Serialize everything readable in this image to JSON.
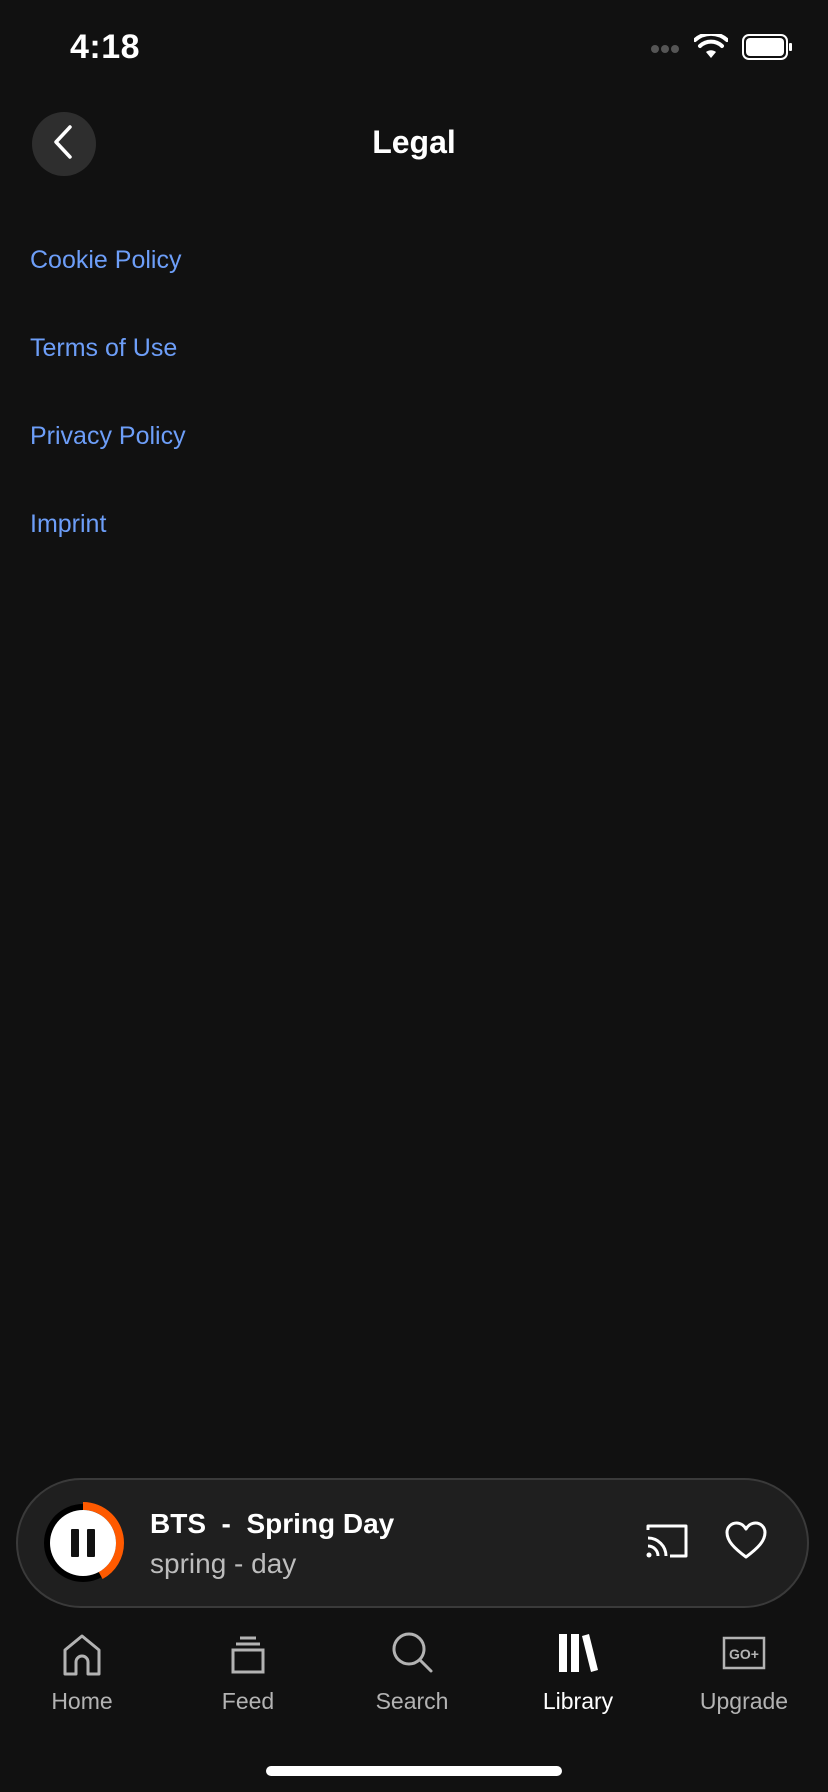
{
  "status_bar": {
    "time": "4:18",
    "icons": [
      "signal-dots-icon",
      "wifi-icon",
      "battery-icon"
    ]
  },
  "header": {
    "title": "Legal",
    "back_icon": "chevron-left-icon"
  },
  "legal_links": [
    {
      "label": "Cookie Policy"
    },
    {
      "label": "Terms of Use"
    },
    {
      "label": "Privacy Policy"
    },
    {
      "label": "Imprint"
    }
  ],
  "mini_player": {
    "title": "BTS  -  Spring Day",
    "subtitle": "spring - day",
    "state": "playing",
    "progress": 0.42,
    "accent_color": "#ff5a00",
    "icons": [
      "pause-icon",
      "cast-icon",
      "heart-icon"
    ]
  },
  "bottom_nav": {
    "active": "Library",
    "items": [
      {
        "label": "Home",
        "icon": "home-icon"
      },
      {
        "label": "Feed",
        "icon": "feed-icon"
      },
      {
        "label": "Search",
        "icon": "search-icon"
      },
      {
        "label": "Library",
        "icon": "library-icon"
      },
      {
        "label": "Upgrade",
        "icon": "go-plus-icon"
      }
    ]
  },
  "colors": {
    "background": "#111111",
    "link": "#6d9ef8",
    "accent": "#ff5a00"
  }
}
